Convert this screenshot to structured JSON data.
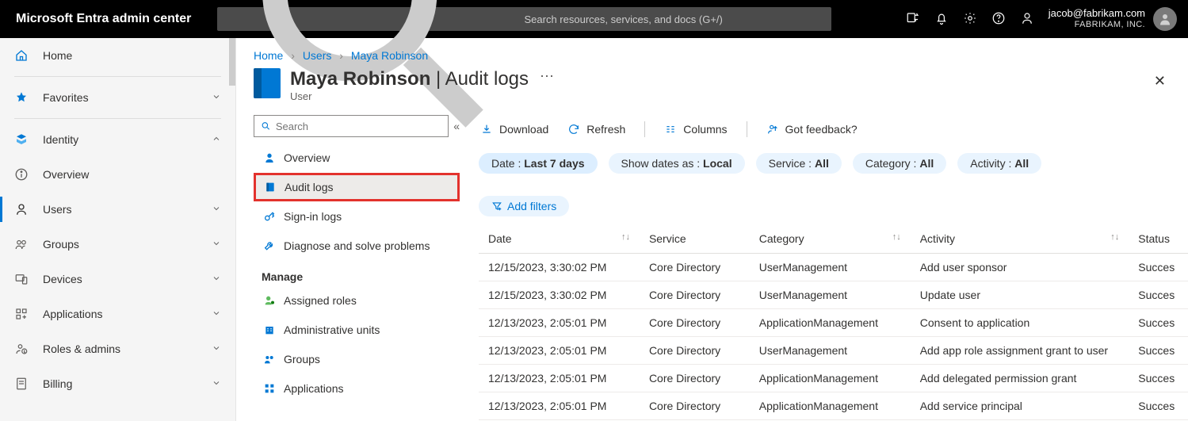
{
  "brand": "Microsoft Entra admin center",
  "search_placeholder": "Search resources, services, and docs (G+/)",
  "account": {
    "email": "jacob@fabrikam.com",
    "org": "FABRIKAM, INC."
  },
  "leftnav": {
    "home": "Home",
    "favorites": "Favorites",
    "identity": "Identity",
    "items": [
      {
        "label": "Overview"
      },
      {
        "label": "Users"
      },
      {
        "label": "Groups"
      },
      {
        "label": "Devices"
      },
      {
        "label": "Applications"
      },
      {
        "label": "Roles & admins"
      },
      {
        "label": "Billing"
      }
    ]
  },
  "breadcrumb": {
    "home": "Home",
    "users": "Users",
    "current": "Maya Robinson"
  },
  "blade": {
    "title": "Maya Robinson",
    "subtitle": "Audit logs",
    "type": "User",
    "search_placeholder": "Search",
    "nav": {
      "overview": "Overview",
      "audit_logs": "Audit logs",
      "signin_logs": "Sign-in logs",
      "diagnose": "Diagnose and solve problems",
      "manage": "Manage",
      "assigned_roles": "Assigned roles",
      "admin_units": "Administrative units",
      "groups": "Groups",
      "applications": "Applications"
    }
  },
  "toolbar": {
    "download": "Download",
    "refresh": "Refresh",
    "columns": "Columns",
    "feedback": "Got feedback?"
  },
  "filters": {
    "date_label": "Date : ",
    "date_value": "Last 7 days",
    "dates_as_label": "Show dates as : ",
    "dates_as_value": "Local",
    "service_label": "Service : ",
    "service_value": "All",
    "category_label": "Category : ",
    "category_value": "All",
    "activity_label": "Activity : ",
    "activity_value": "All",
    "add_filters": "Add filters"
  },
  "columns": {
    "date": "Date",
    "service": "Service",
    "category": "Category",
    "activity": "Activity",
    "status": "Status"
  },
  "rows": [
    {
      "date": "12/15/2023, 3:30:02 PM",
      "service": "Core Directory",
      "category": "UserManagement",
      "activity": "Add user sponsor",
      "status": "Succes"
    },
    {
      "date": "12/15/2023, 3:30:02 PM",
      "service": "Core Directory",
      "category": "UserManagement",
      "activity": "Update user",
      "status": "Succes"
    },
    {
      "date": "12/13/2023, 2:05:01 PM",
      "service": "Core Directory",
      "category": "ApplicationManagement",
      "activity": "Consent to application",
      "status": "Succes"
    },
    {
      "date": "12/13/2023, 2:05:01 PM",
      "service": "Core Directory",
      "category": "UserManagement",
      "activity": "Add app role assignment grant to user",
      "status": "Succes"
    },
    {
      "date": "12/13/2023, 2:05:01 PM",
      "service": "Core Directory",
      "category": "ApplicationManagement",
      "activity": "Add delegated permission grant",
      "status": "Succes"
    },
    {
      "date": "12/13/2023, 2:05:01 PM",
      "service": "Core Directory",
      "category": "ApplicationManagement",
      "activity": "Add service principal",
      "status": "Succes"
    }
  ]
}
